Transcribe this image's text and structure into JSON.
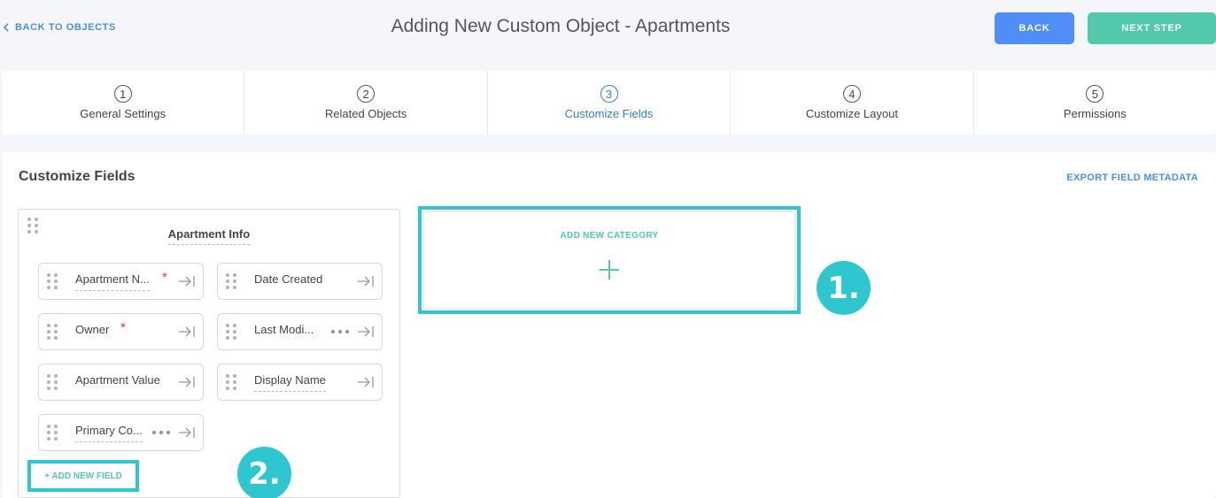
{
  "header": {
    "back_link": "BACK TO OBJECTS",
    "title": "Adding New Custom Object - Apartments",
    "back_button": "BACK",
    "next_button": "NEXT STEP"
  },
  "steps": [
    {
      "num": "1",
      "label": "General Settings"
    },
    {
      "num": "2",
      "label": "Related Objects"
    },
    {
      "num": "3",
      "label": "Customize Fields"
    },
    {
      "num": "4",
      "label": "Customize Layout"
    },
    {
      "num": "5",
      "label": "Permissions"
    }
  ],
  "active_step": 3,
  "section": {
    "title": "Customize Fields",
    "export_link": "EXPORT FIELD METADATA"
  },
  "category": {
    "title": "Apartment Info",
    "fields": [
      {
        "name": "Apartment N...",
        "required": "*"
      },
      {
        "name": "Date Created"
      },
      {
        "name": "Owner",
        "required": "*"
      },
      {
        "name": "Last Modi..."
      },
      {
        "name": "Apartment Value"
      },
      {
        "name": "Display Name"
      },
      {
        "name": "Primary Co..."
      }
    ],
    "add_field": "+ ADD NEW FIELD"
  },
  "add_category": {
    "label": "ADD NEW CATEGORY"
  },
  "annotations": {
    "badge_1": "1.",
    "badge_2": "2."
  },
  "colors": {
    "accent_blue": "#4f8ef7",
    "accent_green": "#52c9ad",
    "highlight_cyan": "#2ec7cf",
    "required_red": "#e53935"
  }
}
